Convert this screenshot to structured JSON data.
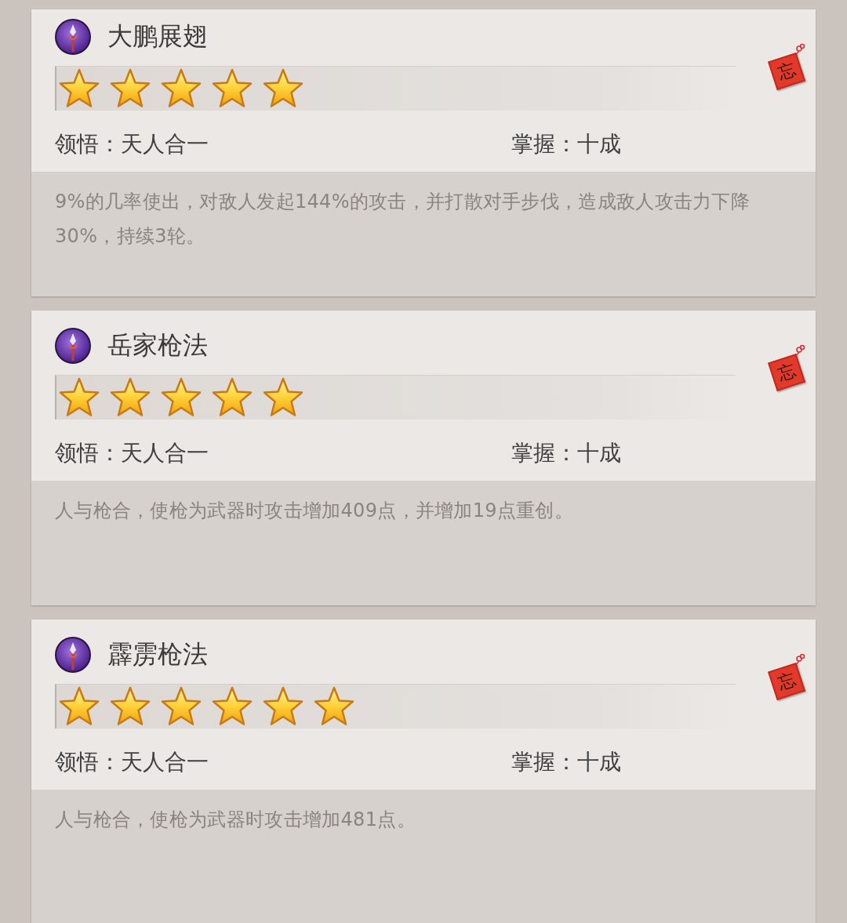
{
  "skills": [
    {
      "name": "大鹏展翅",
      "stars": 5,
      "tag": "忘",
      "comprehension_label": "领悟：",
      "comprehension": "天人合一",
      "mastery_label": "掌握：",
      "mastery": "十成",
      "description": "9%的几率使出，对敌人发起144%的攻击，并打散对手步伐，造成敌人攻击力下降30%，持续3轮。"
    },
    {
      "name": "岳家枪法",
      "stars": 5,
      "tag": "忘",
      "comprehension_label": "领悟：",
      "comprehension": "天人合一",
      "mastery_label": "掌握：",
      "mastery": "十成",
      "description": "人与枪合，使枪为武器时攻击增加409点，并增加19点重创。"
    },
    {
      "name": "霹雳枪法",
      "stars": 6,
      "tag": "忘",
      "comprehension_label": "领悟：",
      "comprehension": "天人合一",
      "mastery_label": "掌握：",
      "mastery": "十成",
      "description": "人与枪合，使枪为武器时攻击增加481点。"
    }
  ]
}
